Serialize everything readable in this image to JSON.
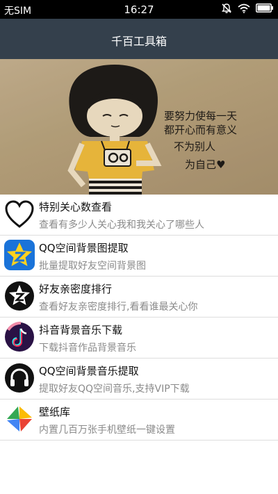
{
  "status_bar": {
    "carrier": "无SIM",
    "time": "16:27",
    "icons": [
      "mute-icon",
      "wifi-icon",
      "battery-icon"
    ]
  },
  "header": {
    "title": "千百工具箱"
  },
  "banner": {
    "handwriting": [
      "要努力使每一天",
      "都开心而有意义",
      "不为别人",
      "为自己♥"
    ]
  },
  "tools": [
    {
      "name": "特别关心数查看",
      "desc": "查看有多少人关心我和我关心了哪些人",
      "icon": "heart-icon"
    },
    {
      "name": "QQ空间背景图提取",
      "desc": "批量提取好友空间背景图",
      "icon": "qzone-icon"
    },
    {
      "name": "好友亲密度排行",
      "desc": "查看好友亲密度排行,看看谁最关心你",
      "icon": "qzone-black-icon"
    },
    {
      "name": "抖音背景音乐下载",
      "desc": "下载抖音作品背景音乐",
      "icon": "douyin-icon"
    },
    {
      "name": "QQ空间背景音乐提取",
      "desc": "提取好友QQ空间音乐,支持VIP下载",
      "icon": "headphones-icon"
    },
    {
      "name": "壁纸库",
      "desc": "内置几百万张手机壁纸一键设置",
      "icon": "wallpaper-pinwheel-icon"
    }
  ]
}
